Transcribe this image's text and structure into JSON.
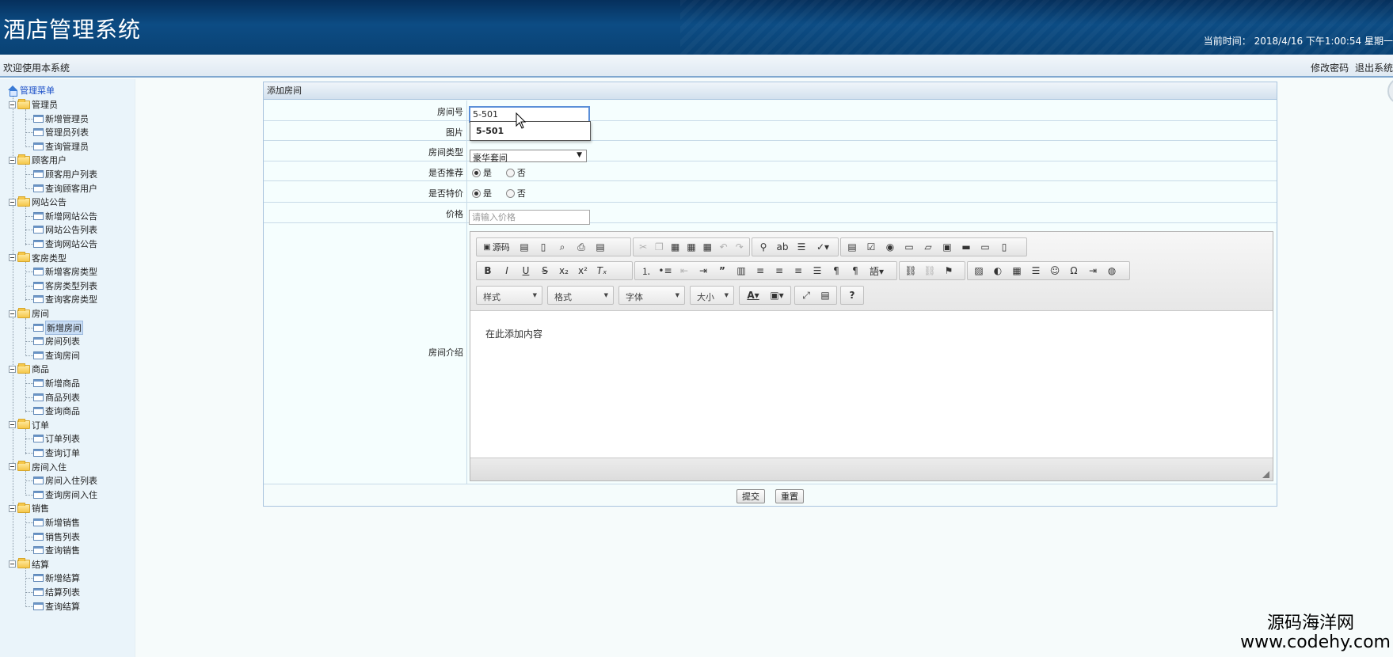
{
  "header": {
    "title": "酒店管理系统",
    "clock_label": "当前时间：",
    "clock_value": "2018/4/16 下午1:00:54 星期一"
  },
  "subbar": {
    "welcome": "欢迎使用本系统",
    "change_password": "修改密码",
    "logout": "退出系统"
  },
  "sidebar": {
    "root": "管理菜单",
    "groups": [
      {
        "label": "管理员",
        "items": [
          "新增管理员",
          "管理员列表",
          "查询管理员"
        ]
      },
      {
        "label": "顾客用户",
        "items": [
          "顾客用户列表",
          "查询顾客用户"
        ]
      },
      {
        "label": "网站公告",
        "items": [
          "新增网站公告",
          "网站公告列表",
          "查询网站公告"
        ]
      },
      {
        "label": "客房类型",
        "items": [
          "新增客房类型",
          "客房类型列表",
          "查询客房类型"
        ]
      },
      {
        "label": "房间",
        "items": [
          "新增房间",
          "房间列表",
          "查询房间"
        ],
        "selected": 0
      },
      {
        "label": "商品",
        "items": [
          "新增商品",
          "商品列表",
          "查询商品"
        ]
      },
      {
        "label": "订单",
        "items": [
          "订单列表",
          "查询订单"
        ]
      },
      {
        "label": "房间入住",
        "items": [
          "房间入住列表",
          "查询房间入住"
        ]
      },
      {
        "label": "销售",
        "items": [
          "新增销售",
          "销售列表",
          "查询销售"
        ]
      },
      {
        "label": "结算",
        "items": [
          "新增结算",
          "结算列表",
          "查询结算"
        ]
      }
    ]
  },
  "form": {
    "panel_title": "添加房间",
    "room_no_label": "房间号",
    "room_no_value": "5-501",
    "autocomplete_option": "5-501",
    "image_label": "图片",
    "room_type_label": "房间类型",
    "room_type_value": "豪华套间",
    "recommended_label": "是否推荐",
    "special_label": "是否特价",
    "yes": "是",
    "no": "否",
    "price_label": "价格",
    "price_placeholder": "请输入价格",
    "intro_label": "房间介绍",
    "editor_placeholder": "在此添加内容",
    "submit": "提交",
    "reset": "重置"
  },
  "editor_toolbar": {
    "source": "源码",
    "combos": [
      "样式",
      "格式",
      "字体",
      "大小"
    ]
  },
  "watermark": {
    "line1": "源码海洋网",
    "line2": "www.codehy.com"
  }
}
